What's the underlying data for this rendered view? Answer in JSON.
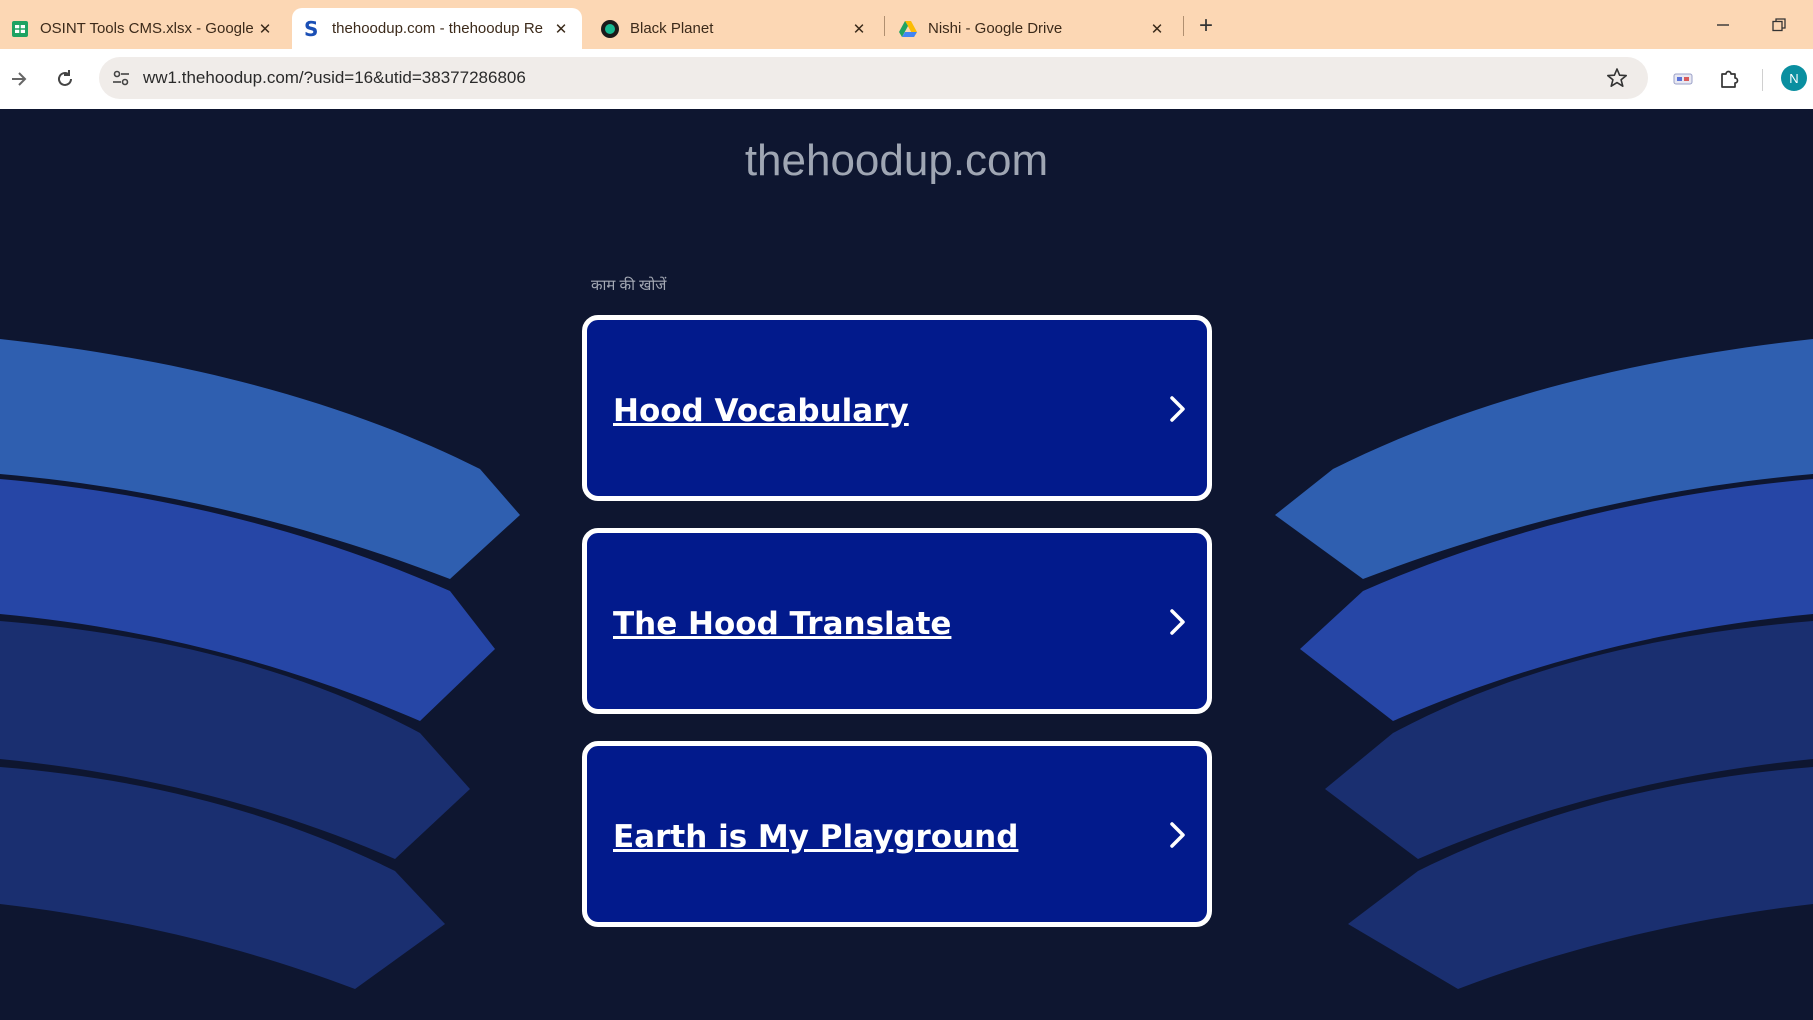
{
  "browser": {
    "tabs": [
      {
        "title": "OSINT Tools CMS.xlsx - Google",
        "favicon": "sheets-icon",
        "active": false
      },
      {
        "title": "thehoodup.com - thehoodup Re",
        "favicon": "s-logo-icon",
        "active": true
      },
      {
        "title": "Black Planet",
        "favicon": "blackplanet-icon",
        "active": false
      },
      {
        "title": "Nishi - Google Drive",
        "favicon": "drive-icon",
        "active": false
      }
    ],
    "address": "ww1.thehoodup.com/?usid=16&utid=38377286806",
    "profile_initial": "N"
  },
  "page": {
    "site_title": "thehoodup.com",
    "search_hint": "काम की खोजें",
    "links": [
      {
        "label": "Hood Vocabulary"
      },
      {
        "label": "The Hood Translate"
      },
      {
        "label": "Earth is My Playground"
      }
    ]
  },
  "colors": {
    "tabstrip": "#fcd7b4",
    "page_background": "#0e1630",
    "card_fill": "#021a8c",
    "card_border": "#ffffff",
    "wave_light": "#2f5fb0",
    "wave_mid": "#2646a6",
    "wave_dark": "#1a2f70"
  }
}
